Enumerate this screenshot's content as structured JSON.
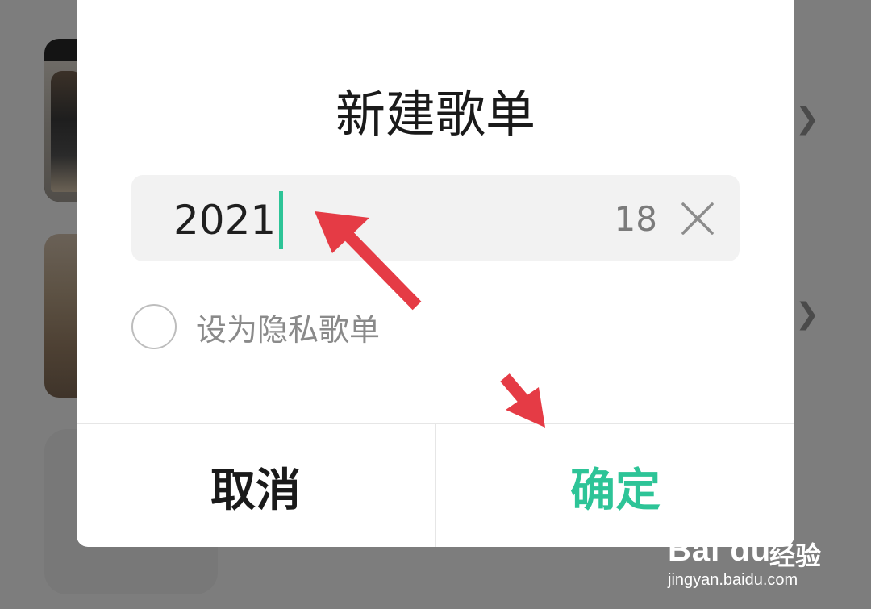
{
  "dialog": {
    "title": "新建歌单",
    "name_field": {
      "value": "2021",
      "char_count": "18"
    },
    "privacy_label": "设为隐私歌单",
    "privacy_checked": false,
    "cancel_label": "取消",
    "confirm_label": "确定"
  },
  "colors": {
    "accent": "#2dc497",
    "annotation_arrow": "#e53b45",
    "overlay": "#7d7d7d"
  },
  "icons": {
    "clear": "close-icon",
    "list_chevron": "chevron-right-icon"
  },
  "watermark": {
    "logo": "Bai du",
    "logo_cn": "经验",
    "url": "jingyan.baidu.com"
  }
}
